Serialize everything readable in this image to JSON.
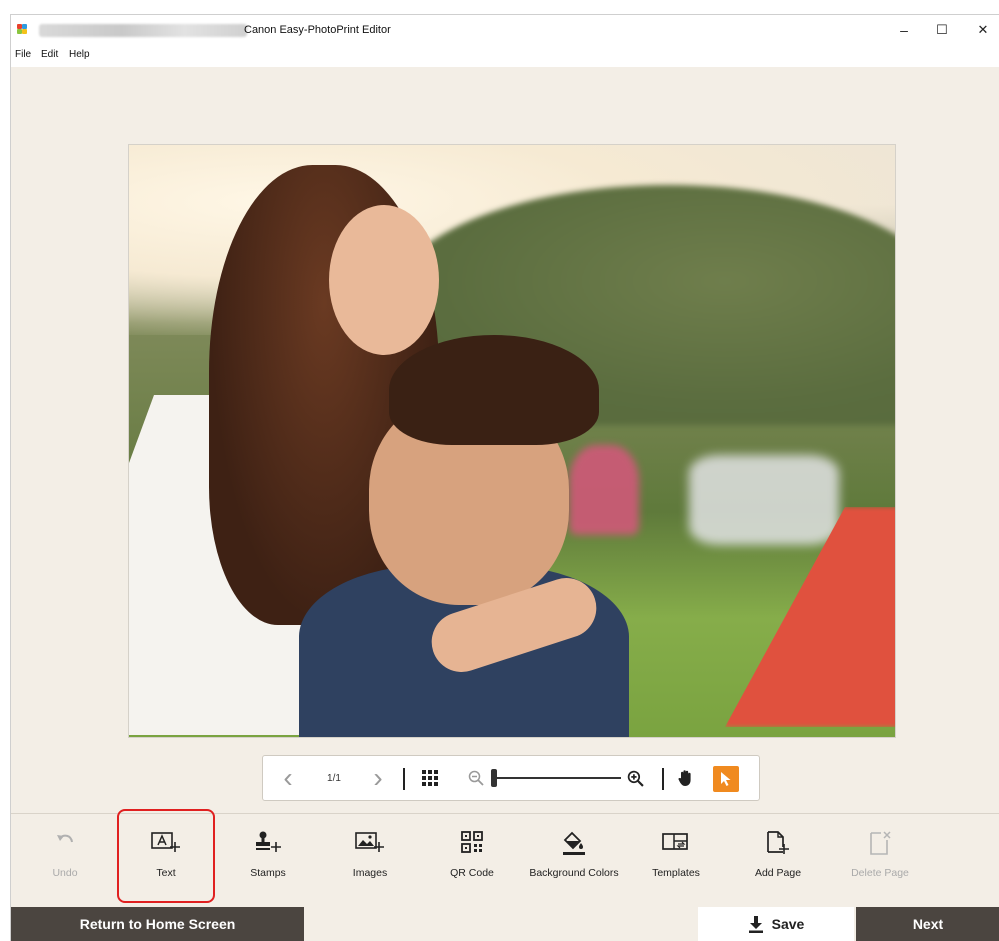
{
  "window": {
    "title": "Canon Easy-PhotoPrint Editor",
    "minimize_glyph": "–",
    "maximize_glyph": "☐",
    "close_glyph": "✕"
  },
  "menu": [
    "File",
    "Edit",
    "Help"
  ],
  "navbar": {
    "page_indicator": "1/1",
    "prev_glyph": "‹",
    "next_glyph": "›"
  },
  "tools": [
    {
      "label": "Undo",
      "icon": "undo-icon",
      "enabled": false
    },
    {
      "label": "Text",
      "icon": "text-add-icon",
      "enabled": true
    },
    {
      "label": "Stamps",
      "icon": "stamp-add-icon",
      "enabled": true
    },
    {
      "label": "Images",
      "icon": "image-add-icon",
      "enabled": true
    },
    {
      "label": "QR Code",
      "icon": "qr-code-icon",
      "enabled": true
    },
    {
      "label": "Background Colors",
      "icon": "paint-bucket-icon",
      "enabled": true
    },
    {
      "label": "Templates",
      "icon": "templates-icon",
      "enabled": true
    },
    {
      "label": "Add Page",
      "icon": "add-page-icon",
      "enabled": true
    },
    {
      "label": "Delete Page",
      "icon": "delete-page-icon",
      "enabled": false
    }
  ],
  "footer": {
    "home_label": "Return to Home Screen",
    "save_label": "Save",
    "next_label": "Next"
  },
  "colors": {
    "accent_orange": "#f08a1f",
    "dark_button": "#4b4540",
    "highlight_red": "#e02020",
    "workspace": "#f3eee6"
  }
}
